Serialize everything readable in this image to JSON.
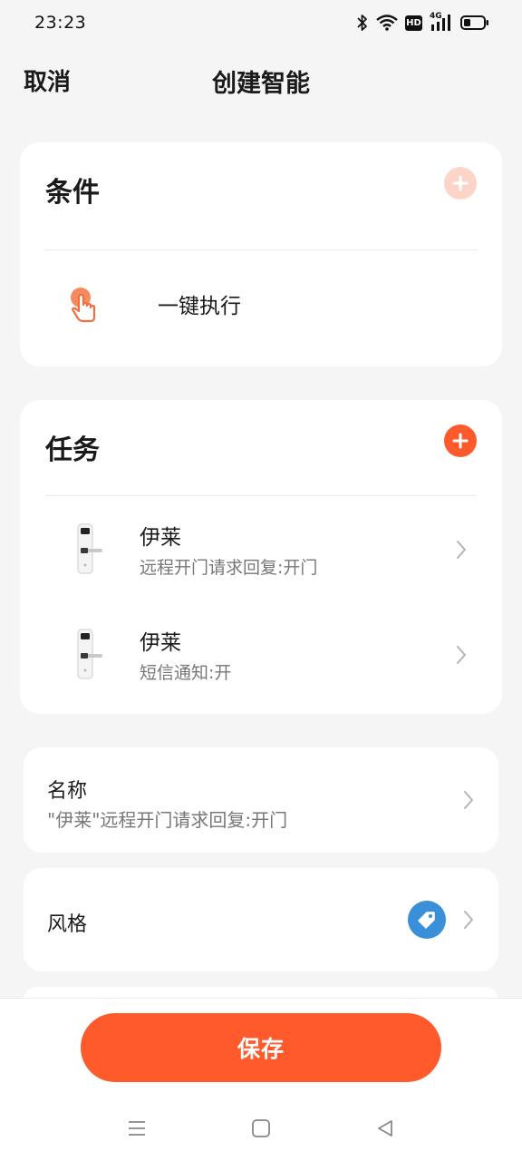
{
  "status_bar": {
    "time": "23:23",
    "icons": [
      "bluetooth-icon",
      "wifi-icon",
      "hd-icon",
      "signal-4g-icon",
      "battery-icon"
    ],
    "hd_label": "HD",
    "network_label": "4G"
  },
  "header": {
    "cancel_label": "取消",
    "title": "创建智能"
  },
  "conditions": {
    "title": "条件",
    "add_icon": "plus-icon",
    "add_color": "#fcd5c8",
    "items": [
      {
        "icon": "touch-hand-icon",
        "label": "一键执行"
      }
    ]
  },
  "tasks": {
    "title": "任务",
    "add_icon": "plus-icon",
    "add_color": "#fe5a2b",
    "items": [
      {
        "icon": "door-lock-icon",
        "title": "伊莱",
        "subtitle": "远程开门请求回复:开门"
      },
      {
        "icon": "door-lock-icon",
        "title": "伊莱",
        "subtitle": "短信通知:开"
      }
    ]
  },
  "settings": {
    "name_label": "名称",
    "name_value": "\"伊莱\"远程开门请求回复:开门",
    "style_label": "风格",
    "style_icon": "tag-icon",
    "style_color": "#3a8fd9"
  },
  "save_label": "保存",
  "nav": {
    "items": [
      "menu-icon",
      "home-icon",
      "back-icon"
    ]
  },
  "colors": {
    "accent": "#fe5a2b",
    "background": "#f5f5f5"
  }
}
